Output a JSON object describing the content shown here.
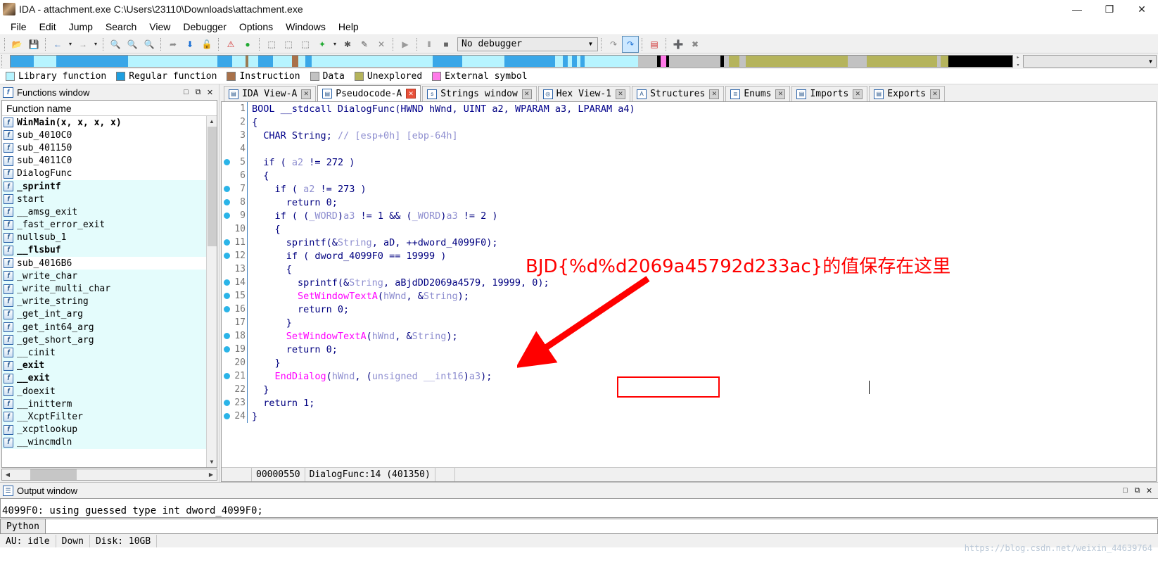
{
  "window": {
    "title": "IDA - attachment.exe C:\\Users\\23110\\Downloads\\attachment.exe",
    "app_icon": "ida-logo-icon",
    "minimize": "—",
    "maximize": "❐",
    "close": "✕"
  },
  "menu": [
    "File",
    "Edit",
    "Jump",
    "Search",
    "View",
    "Debugger",
    "Options",
    "Windows",
    "Help"
  ],
  "toolbar": {
    "debugger_select": "No debugger",
    "dropdown_caret": "▼",
    "buttons": [
      {
        "name": "open-file-button",
        "glyph": "📂",
        "color": "#e8a33d"
      },
      {
        "name": "save-file-button",
        "glyph": "💾",
        "color": "#b05ac0"
      },
      {
        "name": "back-button",
        "glyph": "←",
        "color": "#2f6fbf"
      },
      {
        "name": "back-dropdown-button",
        "glyph": "▾",
        "color": "#222222"
      },
      {
        "name": "forward-button",
        "glyph": "→",
        "color": "#9a9a9a"
      },
      {
        "name": "forward-dropdown-button",
        "glyph": "▾",
        "color": "#222222"
      },
      {
        "name": "search-hex-button",
        "glyph": "🔍",
        "color": "#2f6fbf"
      },
      {
        "name": "search-text-button",
        "glyph": "🔍",
        "color": "#2f6fbf"
      },
      {
        "name": "search-sequence-button",
        "glyph": "🔍",
        "color": "#2f6fbf"
      },
      {
        "name": "jump-to-button",
        "glyph": "➦",
        "color": "#8d8d8d"
      },
      {
        "name": "jump-down-button",
        "glyph": "⬇",
        "color": "#1a6fd4"
      },
      {
        "name": "unlock-button",
        "glyph": "🔓",
        "color": "#8d8d8d"
      },
      {
        "name": "warning-button",
        "glyph": "⚠",
        "color": "#cf2b2b"
      },
      {
        "name": "run-green-button",
        "glyph": "●",
        "color": "#22aa33"
      },
      {
        "name": "make-code-button",
        "glyph": "⬚",
        "color": "#555555"
      },
      {
        "name": "make-data-button",
        "glyph": "⬚",
        "color": "#555555"
      },
      {
        "name": "make-array-button",
        "glyph": "⬚",
        "color": "#555555"
      },
      {
        "name": "make-struct-button",
        "glyph": "✦",
        "color": "#22aa33"
      },
      {
        "name": "struct-dropdown-button",
        "glyph": "▾",
        "color": "#222222"
      },
      {
        "name": "undefine-button",
        "glyph": "✱",
        "color": "#555555"
      },
      {
        "name": "rename-button",
        "glyph": "✎",
        "color": "#555555"
      },
      {
        "name": "delete-button",
        "glyph": "✕",
        "color": "#888888"
      },
      {
        "name": "run-button",
        "glyph": "▶",
        "color": "#9a9a9a"
      },
      {
        "name": "pause-button",
        "glyph": "‖",
        "color": "#666666"
      },
      {
        "name": "stop-button",
        "glyph": "■",
        "color": "#666666"
      },
      {
        "name": "step-over-button",
        "glyph": "↷",
        "color": "#888888"
      },
      {
        "name": "decompile-button",
        "glyph": "↷",
        "color": "#1a6fd4"
      },
      {
        "name": "breakpoints-button",
        "glyph": "▤",
        "color": "#cf2b2b"
      },
      {
        "name": "add-breakpoint-button",
        "glyph": "➕",
        "color": "#22aa33"
      },
      {
        "name": "del-breakpoint-button",
        "glyph": "✖",
        "color": "#888888"
      }
    ]
  },
  "navband": {
    "segments": [
      {
        "color": "#3aa7e8",
        "width": 3.6
      },
      {
        "color": "#b7f4ff",
        "width": 3.6
      },
      {
        "color": "#3aa7e8",
        "width": 11.2
      },
      {
        "color": "#b7f4ff",
        "width": 14.0
      },
      {
        "color": "#3aa7e8",
        "width": 2.4
      },
      {
        "color": "#b7f4ff",
        "width": 2.0
      },
      {
        "color": "#9a7a52",
        "width": 0.5
      },
      {
        "color": "#b7f4ff",
        "width": 1.5
      },
      {
        "color": "#3aa7e8",
        "width": 2.3
      },
      {
        "color": "#b7f4ff",
        "width": 3.0
      },
      {
        "color": "#a8714a",
        "width": 1.0
      },
      {
        "color": "#b7f4ff",
        "width": 1.1
      },
      {
        "color": "#3aa7e8",
        "width": 1.0
      },
      {
        "color": "#b7f4ff",
        "width": 19.0
      },
      {
        "color": "#3aa7e8",
        "width": 4.6
      },
      {
        "color": "#b7f4ff",
        "width": 6.6
      },
      {
        "color": "#3aa7e8",
        "width": 8.0
      },
      {
        "color": "#b7f4ff",
        "width": 1.2
      },
      {
        "color": "#3aa7e8",
        "width": 0.8
      },
      {
        "color": "#b7f4ff",
        "width": 0.6
      },
      {
        "color": "#3aa7e8",
        "width": 0.8
      },
      {
        "color": "#b7f4ff",
        "width": 0.6
      },
      {
        "color": "#3aa7e8",
        "width": 0.6
      },
      {
        "color": "#b7f4ff",
        "width": 8.4
      },
      {
        "color": "#c2c2c2",
        "width": 3.0
      },
      {
        "color": "#000000",
        "width": 0.6
      },
      {
        "color": "#ff7ae8",
        "width": 0.8
      },
      {
        "color": "#000000",
        "width": 0.5
      },
      {
        "color": "#c2c2c2",
        "width": 2.0
      },
      {
        "color": "#c2c2c2",
        "width": 6.0
      },
      {
        "color": "#000000",
        "width": 0.6
      },
      {
        "color": "#c2c2c2",
        "width": 0.8
      },
      {
        "color": "#b5b45c",
        "width": 1.6
      },
      {
        "color": "#c2c2c2",
        "width": 1.0
      },
      {
        "color": "#b5b45c",
        "width": 16.0
      },
      {
        "color": "#c2c2c2",
        "width": 3.0
      },
      {
        "color": "#b5b45c",
        "width": 11.0
      },
      {
        "color": "#c2c2c2",
        "width": 0.6
      },
      {
        "color": "#b5b45c",
        "width": 1.2
      },
      {
        "color": "#000000",
        "width": 10.0
      }
    ]
  },
  "legend": [
    {
      "label": "Library function",
      "color": "#b7f4ff"
    },
    {
      "label": "Regular function",
      "color": "#1e9fe0"
    },
    {
      "label": "Instruction",
      "color": "#a8714a"
    },
    {
      "label": "Data",
      "color": "#c2c2c2"
    },
    {
      "label": "Unexplored",
      "color": "#b5b45c"
    },
    {
      "label": "External symbol",
      "color": "#ff7ae8"
    }
  ],
  "functions_window": {
    "title": "Functions window",
    "column_header": "Function name",
    "rows": [
      {
        "name": "WinMain(x, x, x, x)",
        "lib": false,
        "bold": true
      },
      {
        "name": "sub_4010C0",
        "lib": false,
        "bold": false
      },
      {
        "name": "sub_401150",
        "lib": false,
        "bold": false
      },
      {
        "name": "sub_4011C0",
        "lib": false,
        "bold": false
      },
      {
        "name": "DialogFunc",
        "lib": false,
        "bold": false
      },
      {
        "name": "_sprintf",
        "lib": true,
        "bold": true
      },
      {
        "name": "start",
        "lib": true,
        "bold": false
      },
      {
        "name": "__amsg_exit",
        "lib": true,
        "bold": false
      },
      {
        "name": "_fast_error_exit",
        "lib": true,
        "bold": false
      },
      {
        "name": "nullsub_1",
        "lib": true,
        "bold": false
      },
      {
        "name": "__flsbuf",
        "lib": true,
        "bold": true
      },
      {
        "name": "sub_4016B6",
        "lib": false,
        "bold": false
      },
      {
        "name": "_write_char",
        "lib": true,
        "bold": false
      },
      {
        "name": "_write_multi_char",
        "lib": true,
        "bold": false
      },
      {
        "name": "_write_string",
        "lib": true,
        "bold": false
      },
      {
        "name": "_get_int_arg",
        "lib": true,
        "bold": false
      },
      {
        "name": "_get_int64_arg",
        "lib": true,
        "bold": false
      },
      {
        "name": "_get_short_arg",
        "lib": true,
        "bold": false
      },
      {
        "name": "__cinit",
        "lib": true,
        "bold": false
      },
      {
        "name": "_exit",
        "lib": true,
        "bold": true
      },
      {
        "name": "__exit",
        "lib": true,
        "bold": true
      },
      {
        "name": "_doexit",
        "lib": true,
        "bold": false
      },
      {
        "name": "__initterm",
        "lib": true,
        "bold": false
      },
      {
        "name": "__XcptFilter",
        "lib": true,
        "bold": false
      },
      {
        "name": "_xcptlookup",
        "lib": true,
        "bold": false
      },
      {
        "name": "__wincmdln",
        "lib": true,
        "bold": false
      }
    ],
    "panel_buttons": [
      "□",
      "⧉",
      "✕"
    ]
  },
  "tabs": [
    {
      "label": "IDA View-A",
      "icon": "ida-view-icon",
      "glyph": "▤",
      "active": false,
      "close": "✕"
    },
    {
      "label": "Pseudocode-A",
      "icon": "pseudocode-icon",
      "glyph": "▤",
      "active": true,
      "close": "✕"
    },
    {
      "label": "Strings window",
      "icon": "strings-icon",
      "glyph": "s",
      "active": false,
      "close": "✕"
    },
    {
      "label": "Hex View-1",
      "icon": "hex-view-icon",
      "glyph": "◎",
      "active": false,
      "close": "✕"
    },
    {
      "label": "Structures",
      "icon": "structures-icon",
      "glyph": "A",
      "active": false,
      "close": "✕"
    },
    {
      "label": "Enums",
      "icon": "enums-icon",
      "glyph": "≣",
      "active": false,
      "close": "✕"
    },
    {
      "label": "Imports",
      "icon": "imports-icon",
      "glyph": "▤",
      "active": false,
      "close": "✕"
    },
    {
      "label": "Exports",
      "icon": "exports-icon",
      "glyph": "▤",
      "active": false,
      "close": "✕"
    }
  ],
  "code": {
    "lines": [
      {
        "n": "1",
        "bp": false,
        "tokens": [
          [
            "BOOL ",
            "t"
          ],
          [
            "__stdcall ",
            "t"
          ],
          [
            "DialogFunc",
            "p"
          ],
          [
            "(",
            "p"
          ],
          [
            "HWND ",
            "t"
          ],
          [
            "hWnd",
            "p"
          ],
          [
            ", ",
            "p"
          ],
          [
            "UINT ",
            "t"
          ],
          [
            "a2",
            "p"
          ],
          [
            ", ",
            "p"
          ],
          [
            "WPARAM ",
            "t"
          ],
          [
            "a3",
            "p"
          ],
          [
            ", ",
            "p"
          ],
          [
            "LPARAM ",
            "t"
          ],
          [
            "a4",
            "p"
          ],
          [
            ")",
            "p"
          ]
        ]
      },
      {
        "n": "2",
        "bp": false,
        "tokens": [
          [
            "{",
            "p"
          ]
        ]
      },
      {
        "n": "3",
        "bp": false,
        "tokens": [
          [
            "  CHAR ",
            "t"
          ],
          [
            "String",
            "p"
          ],
          [
            "; ",
            "p"
          ],
          [
            "// ",
            "c"
          ],
          [
            "[esp+0h] [ebp-64h]",
            "c"
          ]
        ]
      },
      {
        "n": "4",
        "bp": false,
        "tokens": [
          [
            "",
            "p"
          ]
        ]
      },
      {
        "n": "5",
        "bp": true,
        "tokens": [
          [
            "  if ( ",
            "p"
          ],
          [
            "a2",
            "v"
          ],
          [
            " != ",
            "p"
          ],
          [
            "272",
            "p"
          ],
          [
            " )",
            "p"
          ]
        ]
      },
      {
        "n": "6",
        "bp": false,
        "tokens": [
          [
            "  {",
            "p"
          ]
        ]
      },
      {
        "n": "7",
        "bp": true,
        "tokens": [
          [
            "    if ( ",
            "p"
          ],
          [
            "a2",
            "v"
          ],
          [
            " != ",
            "p"
          ],
          [
            "273",
            "p"
          ],
          [
            " )",
            "p"
          ]
        ]
      },
      {
        "n": "8",
        "bp": true,
        "tokens": [
          [
            "      return 0;",
            "p"
          ]
        ]
      },
      {
        "n": "9",
        "bp": true,
        "tokens": [
          [
            "    if ( (",
            "p"
          ],
          [
            "_WORD",
            "c"
          ],
          [
            ")",
            "p"
          ],
          [
            "a3",
            "v"
          ],
          [
            " != 1 && (",
            "p"
          ],
          [
            "_WORD",
            "c"
          ],
          [
            ")",
            "p"
          ],
          [
            "a3",
            "v"
          ],
          [
            " != 2 )",
            "p"
          ]
        ]
      },
      {
        "n": "10",
        "bp": false,
        "tokens": [
          [
            "    {",
            "p"
          ]
        ]
      },
      {
        "n": "11",
        "bp": true,
        "tokens": [
          [
            "      sprintf(&",
            "p"
          ],
          [
            "String",
            "v"
          ],
          [
            ", aD, ++dword_4099F0);",
            "p"
          ]
        ]
      },
      {
        "n": "12",
        "bp": true,
        "tokens": [
          [
            "      if ( dword_4099F0 == 19999 )",
            "p"
          ]
        ]
      },
      {
        "n": "13",
        "bp": false,
        "tokens": [
          [
            "      {",
            "p"
          ]
        ]
      },
      {
        "n": "14",
        "bp": true,
        "tokens": [
          [
            "        sprintf(&",
            "p"
          ],
          [
            "String",
            "v"
          ],
          [
            ", ",
            "p"
          ],
          [
            "aBjdDD2069a4579",
            "p"
          ],
          [
            ", 19999, 0);",
            "p"
          ]
        ]
      },
      {
        "n": "15",
        "bp": true,
        "tokens": [
          [
            "        ",
            "p"
          ],
          [
            "SetWindowTextA",
            "f"
          ],
          [
            "(",
            "p"
          ],
          [
            "hWnd",
            "v"
          ],
          [
            ", &",
            "p"
          ],
          [
            "String",
            "v"
          ],
          [
            ");",
            "p"
          ]
        ]
      },
      {
        "n": "16",
        "bp": true,
        "tokens": [
          [
            "        return 0;",
            "p"
          ]
        ]
      },
      {
        "n": "17",
        "bp": false,
        "tokens": [
          [
            "      }",
            "p"
          ]
        ]
      },
      {
        "n": "18",
        "bp": true,
        "tokens": [
          [
            "      ",
            "p"
          ],
          [
            "SetWindowTextA",
            "f"
          ],
          [
            "(",
            "p"
          ],
          [
            "hWnd",
            "v"
          ],
          [
            ", &",
            "p"
          ],
          [
            "String",
            "v"
          ],
          [
            ");",
            "p"
          ]
        ]
      },
      {
        "n": "19",
        "bp": true,
        "tokens": [
          [
            "      return 0;",
            "p"
          ]
        ]
      },
      {
        "n": "20",
        "bp": false,
        "tokens": [
          [
            "    }",
            "p"
          ]
        ]
      },
      {
        "n": "21",
        "bp": true,
        "tokens": [
          [
            "    ",
            "p"
          ],
          [
            "EndDialog",
            "f"
          ],
          [
            "(",
            "p"
          ],
          [
            "hWnd",
            "v"
          ],
          [
            ", (",
            "p"
          ],
          [
            "unsigned __int16",
            "c"
          ],
          [
            ")",
            "p"
          ],
          [
            "a3",
            "v"
          ],
          [
            ");",
            "p"
          ]
        ]
      },
      {
        "n": "22",
        "bp": false,
        "tokens": [
          [
            "  }",
            "p"
          ]
        ]
      },
      {
        "n": "23",
        "bp": true,
        "tokens": [
          [
            "  return 1;",
            "p"
          ]
        ]
      },
      {
        "n": "24",
        "bp": true,
        "tokens": [
          [
            "}",
            "p"
          ]
        ]
      }
    ]
  },
  "annotation": {
    "text": "BJD{%d%d2069a45792d233ac}的值保存在这里",
    "color": "#ff0000",
    "highlight_target": "aBjdDD2069a4579"
  },
  "editor_status": {
    "offset": "00000550",
    "location": "DialogFunc:14 (401350)"
  },
  "output_window": {
    "title": "Output window",
    "line": "4099F0: using guessed type int dword_4099F0;",
    "panel_buttons": [
      "□",
      "⧉",
      "✕"
    ]
  },
  "cli": {
    "language": "Python",
    "input_value": ""
  },
  "status_bar": {
    "cells": [
      "AU: idle",
      "Down",
      "Disk: 10GB"
    ]
  },
  "watermark": "https://blog.csdn.net/weixin_44639764"
}
